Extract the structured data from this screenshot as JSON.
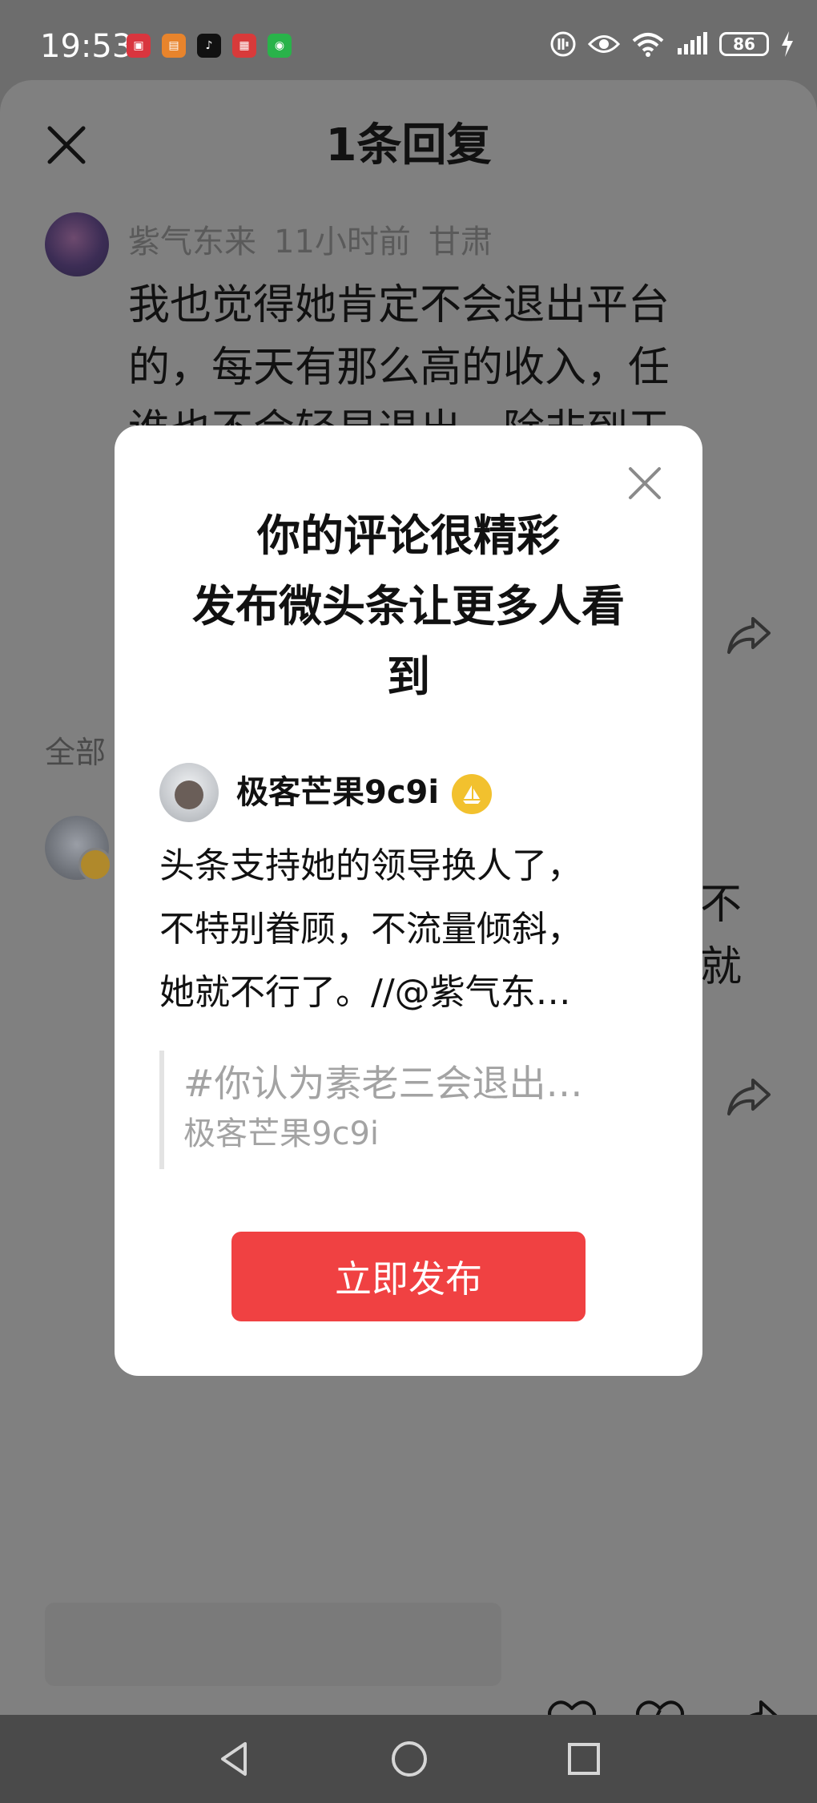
{
  "status_bar": {
    "time": "19:53",
    "battery": "86",
    "app_icons": [
      "huawei-store-icon",
      "app-icon-orange",
      "tiktok-icon",
      "news-icon",
      "wechat-icon"
    ]
  },
  "sheet": {
    "title": "1条回复",
    "comment": {
      "username": "紫气东来",
      "time": "11小时前",
      "location": "甘肃",
      "body_lines": [
        "我也觉得她肯定不会退出平台",
        "的，每天有那么高的收入，任",
        "谁也不会轻易退出，除非到干"
      ]
    },
    "all_label": "全部",
    "reply_partial_lines": [
      "不",
      "就"
    ]
  },
  "modal": {
    "title_lines": [
      "你的评论很精彩",
      "发布微头条让更多人看",
      "到"
    ],
    "author": "极客芒果9c9i",
    "text_lines": [
      "头条支持她的领导换人了，",
      "不特别眷顾，不流量倾斜，",
      "她就不行了。//@紫气东…"
    ],
    "quote_title": "#你认为素老三会退出…",
    "quote_author": "极客芒果9c9i",
    "publish_button": "立即发布"
  },
  "colors": {
    "accent": "#f04142",
    "overlay": "#808080",
    "badge": "#f2c12e"
  }
}
